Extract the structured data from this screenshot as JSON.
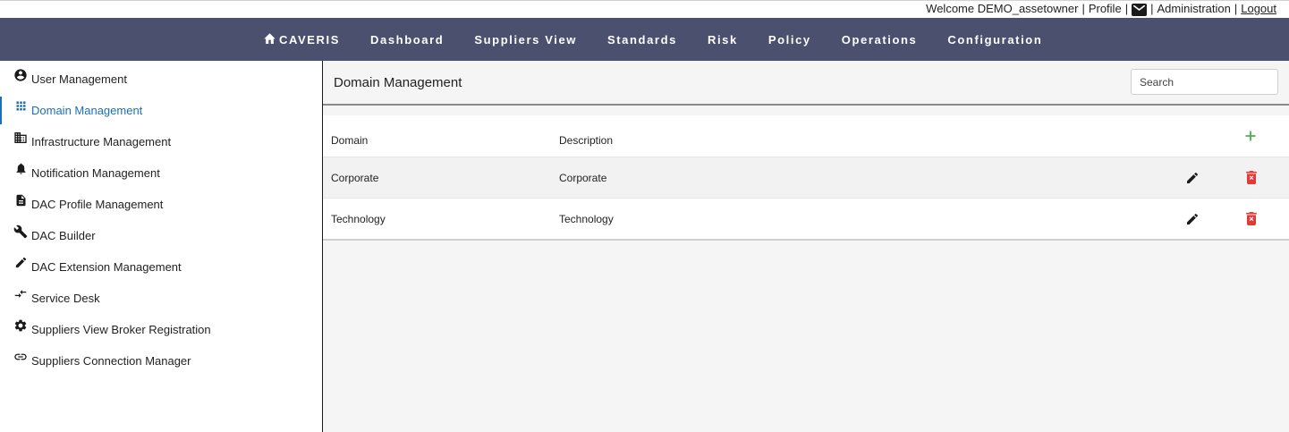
{
  "utility": {
    "welcome": "Welcome DEMO_assetowner",
    "profile": "Profile",
    "mail_icon": "mail-icon",
    "administration": "Administration",
    "logout": "Logout"
  },
  "nav": {
    "brand": "CAVERIS",
    "brand_icon": "home-icon",
    "items": [
      "Dashboard",
      "Suppliers View",
      "Standards",
      "Risk",
      "Policy",
      "Operations",
      "Configuration"
    ]
  },
  "sidebar": {
    "items": [
      {
        "label": "User Management",
        "icon": "account-circle-icon"
      },
      {
        "label": "Domain Management",
        "icon": "grid-icon",
        "active": true
      },
      {
        "label": "Infrastructure Management",
        "icon": "building-icon"
      },
      {
        "label": "Notification Management",
        "icon": "bell-icon"
      },
      {
        "label": "DAC Profile Management",
        "icon": "document-icon"
      },
      {
        "label": "DAC Builder",
        "icon": "wrench-icon"
      },
      {
        "label": "DAC Extension Management",
        "icon": "pencil-icon"
      },
      {
        "label": "Service Desk",
        "icon": "compare-arrows-icon"
      },
      {
        "label": "Suppliers View Broker Registration",
        "icon": "gear-icon"
      },
      {
        "label": "Suppliers Connection Manager",
        "icon": "link-icon"
      }
    ]
  },
  "main": {
    "title": "Domain Management",
    "search_placeholder": "Search",
    "table": {
      "columns": [
        "Domain",
        "Description"
      ],
      "rows": [
        {
          "domain": "Corporate",
          "description": "Corporate"
        },
        {
          "domain": "Technology",
          "description": "Technology"
        }
      ]
    }
  },
  "colors": {
    "navbar": "#4a506e",
    "active": "#1a6fb8",
    "add": "#4caf50",
    "delete": "#e53935"
  }
}
